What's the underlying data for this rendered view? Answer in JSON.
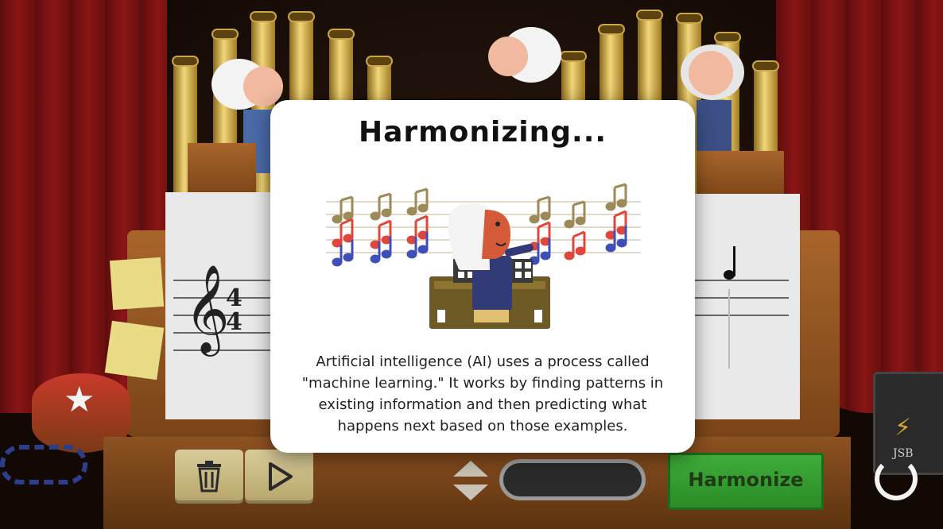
{
  "modal": {
    "title": "Harmonizing...",
    "body": "Artificial intelligence (AI) uses a process called \"machine learning.\" It works by finding patterns in existing information and then predicting what happens next based on those examples."
  },
  "controls": {
    "harmonize_label": "Harmonize",
    "time_signature_top": "4",
    "time_signature_bottom": "4",
    "amp_label": "JSB"
  },
  "icons": {
    "trash": "trash-icon",
    "play": "play-icon",
    "tempo": "up-down-arrows-icon",
    "clef": "treble-clef-icon",
    "spinner": "loading-spinner-icon"
  },
  "colors": {
    "harmonize_green": "#2e9a2b",
    "note_gold": "#9c8a58",
    "note_red": "#e0463c",
    "note_blue": "#3f4fb8",
    "curtain_red": "#7a1212"
  }
}
